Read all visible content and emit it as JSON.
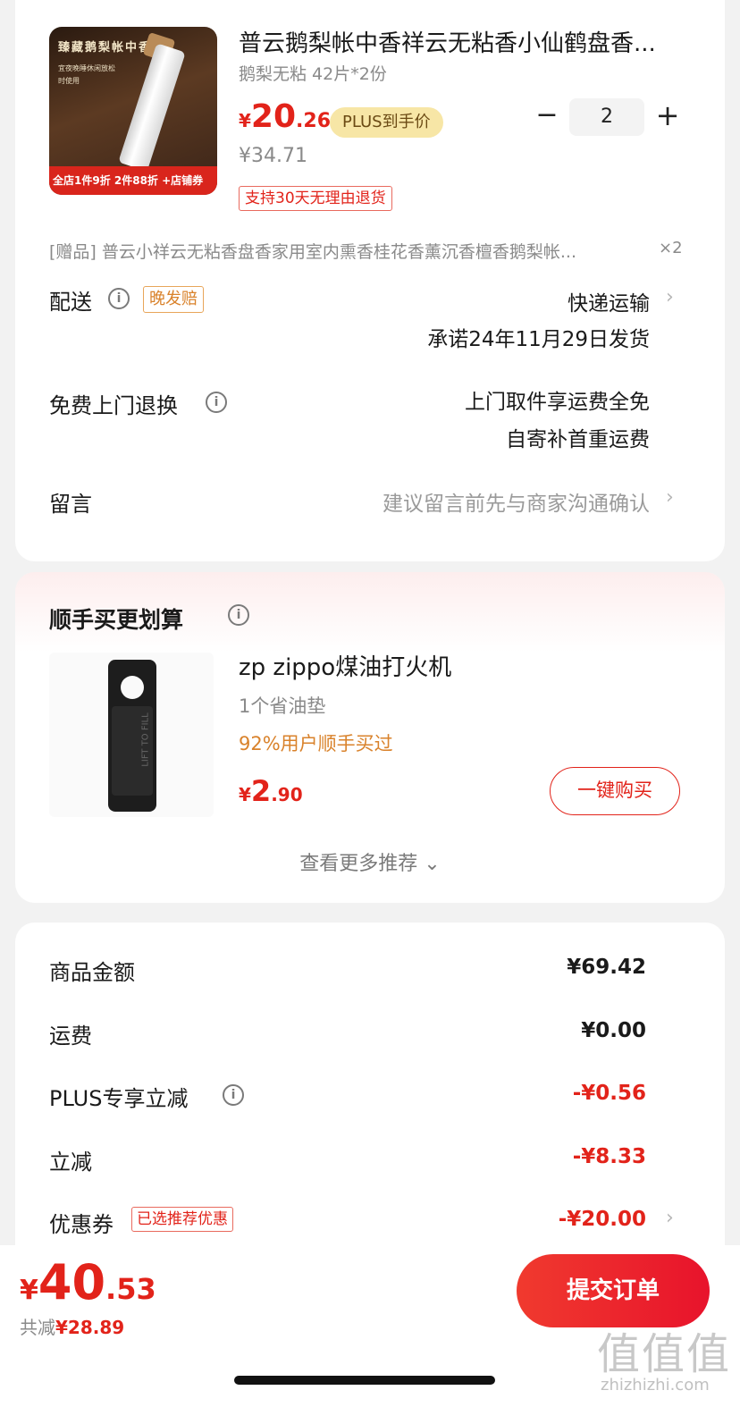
{
  "product": {
    "title": "普云鹅梨帐中香祥云无粘香小仙鹤盘香...",
    "spec": "鹅梨无粘 42片*2份",
    "price_currency": "¥",
    "price_int": "20",
    "price_dec": ".26",
    "plus_tag": "PLUS到手价",
    "original_price": "¥34.71",
    "return_tag": "支持30天无理由退货",
    "qty_minus": "−",
    "quantity": "2",
    "qty_plus": "+",
    "thumb_title": "臻藏鹅梨帐中香",
    "thumb_sub": "宜夜晚睡休闲放松时使用",
    "thumb_band": "全店1件9折 2件88折 +店铺券"
  },
  "gift": {
    "text": "[赠品]  普云小祥云无粘香盘香家用室内熏香桂花香薰沉香檀香鹅梨帐...",
    "count": "×2"
  },
  "delivery": {
    "label": "配送",
    "late_tag": "晚发赔",
    "method": "快递运输",
    "promise": "承诺24年11月29日发货"
  },
  "return_service": {
    "label": "免费上门退换",
    "line1": "上门取件享运费全免",
    "line2": "自寄补首重运费"
  },
  "message": {
    "label": "留言",
    "placeholder": "建议留言前先与商家沟通确认"
  },
  "recommend": {
    "title": "顺手买更划算",
    "item_name": "zp zippo煤油打火机",
    "item_spec": "1个省油垫",
    "item_bought": "92%用户顺手买过",
    "price_currency": "¥",
    "price_int": "2",
    "price_dec": ".90",
    "buy_label": "一键购买",
    "more_label": "查看更多推荐 ⌄",
    "image_text": "LIFT TO FILL"
  },
  "summary": {
    "rows": [
      {
        "label": "商品金额",
        "value": "¥69.42"
      },
      {
        "label": "运费",
        "value": "¥0.00"
      },
      {
        "label": "PLUS专享立减",
        "value": "-¥0.56"
      },
      {
        "label": "立减",
        "value": "-¥8.33"
      },
      {
        "label": "优惠券",
        "value": "-¥20.00"
      }
    ],
    "coupon_tag": "已选推荐优惠"
  },
  "footer": {
    "total_currency": "¥",
    "total_int": "40",
    "total_dec": ".53",
    "saved_label": "共减",
    "saved_amount": "¥28.89",
    "submit_label": "提交订单",
    "watermark": "值值值",
    "watermark_url": "zhizhizhi.com"
  },
  "colors": {
    "accent_red": "#e2231a",
    "orange": "#d9822b",
    "plus_gold": "#f7e6a6"
  },
  "icons": {
    "info": "info-icon",
    "chevron": "chevron-right-icon"
  }
}
